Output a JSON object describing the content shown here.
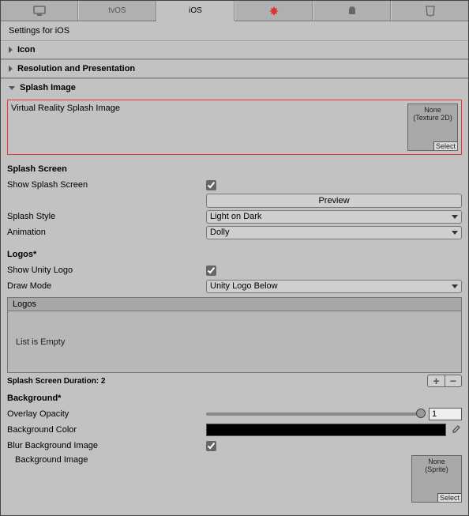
{
  "tabs": {
    "t0": "",
    "t1": "tvOS",
    "t2": "iOS",
    "t3": "",
    "t4": "",
    "t5": ""
  },
  "panel_title": "Settings for iOS",
  "foldouts": {
    "icon": "Icon",
    "resolution": "Resolution and Presentation",
    "splash": "Splash Image"
  },
  "splash": {
    "vr_label": "Virtual Reality Splash Image",
    "tex_none": "None",
    "tex_type": "(Texture 2D)",
    "tex_select": "Select",
    "screen_header": "Splash Screen",
    "show_label": "Show Splash Screen",
    "preview_btn": "Preview",
    "style_label": "Splash Style",
    "style_value": "Light on Dark",
    "anim_label": "Animation",
    "anim_value": "Dolly",
    "logos_header": "Logos*",
    "show_unity_label": "Show Unity Logo",
    "draw_mode_label": "Draw Mode",
    "draw_mode_value": "Unity Logo Below",
    "logos_title": "Logos",
    "logos_empty": "List is Empty",
    "duration_label": "Splash Screen Duration: 2",
    "bg_header": "Background*",
    "overlay_label": "Overlay Opacity",
    "overlay_value": "1",
    "bgcolor_label": "Background Color",
    "blur_label": "Blur Background Image",
    "bgimg_label": "Background Image",
    "bgimg_none": "None",
    "bgimg_type": "(Sprite)",
    "bgimg_select": "Select"
  }
}
